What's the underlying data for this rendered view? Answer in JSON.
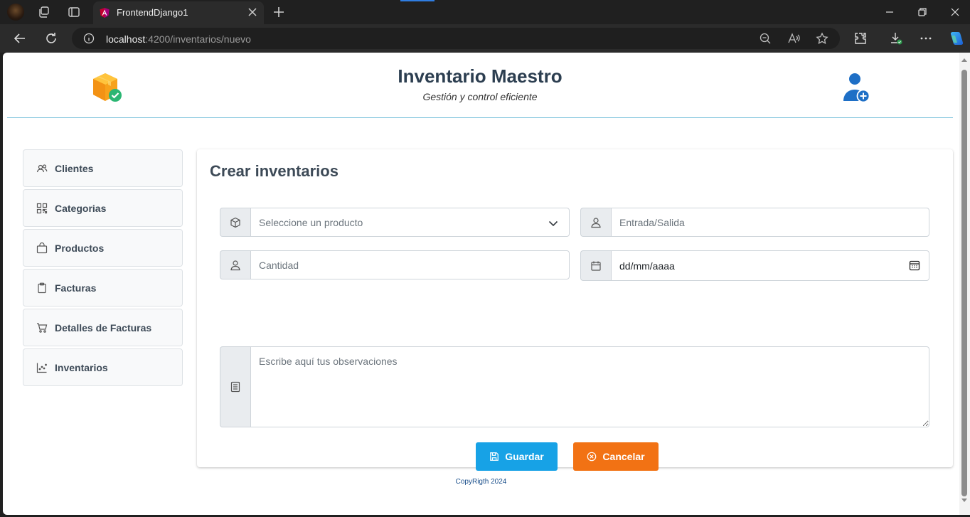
{
  "browser": {
    "tab_title": "FrontendDjango1",
    "url_host": "localhost",
    "url_path": ":4200/inventarios/nuevo"
  },
  "header": {
    "title": "Inventario Maestro",
    "subtitle": "Gestión y control eficiente"
  },
  "sidebar": {
    "items": [
      {
        "label": "Clientes",
        "icon": "users-icon"
      },
      {
        "label": "Categorias",
        "icon": "grid-icon"
      },
      {
        "label": "Productos",
        "icon": "bag-icon"
      },
      {
        "label": "Facturas",
        "icon": "clipboard-icon"
      },
      {
        "label": "Detalles de Facturas",
        "icon": "cart-icon"
      },
      {
        "label": "Inventarios",
        "icon": "chart-icon"
      }
    ]
  },
  "form": {
    "heading": "Crear inventarios",
    "product_select": "Seleccione un producto",
    "type_placeholder": "Entrada/Salida",
    "quantity_placeholder": "Cantidad",
    "date_placeholder": "dd/mm/aaaa",
    "notes_placeholder": "Escribe aquí tus observaciones",
    "save_label": "Guardar",
    "cancel_label": "Cancelar"
  },
  "footer": {
    "text": "CopyRigth 2024"
  },
  "colors": {
    "save": "#17a2e6",
    "cancel": "#f27214",
    "title": "#2c3e50",
    "header_border": "#7fc4dd"
  }
}
